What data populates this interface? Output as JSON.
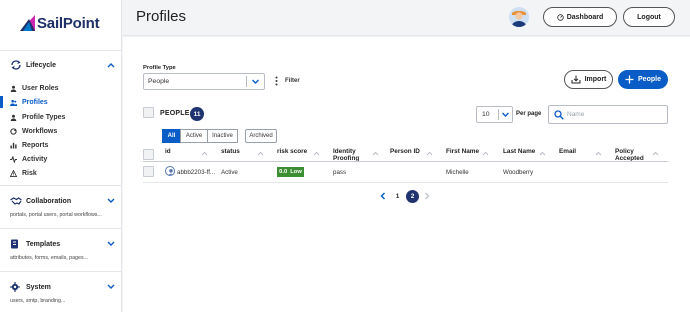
{
  "brand": {
    "name": "SailPoint",
    "color": "#1f2f67",
    "accent": "#0a5cc7"
  },
  "sidebar": {
    "lifecycle": {
      "title": "Lifecycle",
      "items": [
        {
          "label": "User Roles",
          "icon": "user-roles-icon"
        },
        {
          "label": "Profiles",
          "icon": "profiles-icon",
          "active": true
        },
        {
          "label": "Profile Types",
          "icon": "profile-types-icon"
        },
        {
          "label": "Workflows",
          "icon": "workflows-icon"
        },
        {
          "label": "Reports",
          "icon": "reports-icon"
        },
        {
          "label": "Activity",
          "icon": "activity-icon"
        },
        {
          "label": "Risk",
          "icon": "risk-icon"
        }
      ]
    },
    "collaboration": {
      "title": "Collaboration",
      "desc": "portals, portal users, portal workflows..."
    },
    "templates": {
      "title": "Templates",
      "desc": "attributes, forms, emails, pages..."
    },
    "system": {
      "title": "System",
      "desc": "users, smtp, branding..."
    }
  },
  "header": {
    "title": "Profiles",
    "dashboard_label": "Dashboard",
    "logout_label": "Logout"
  },
  "toolbar": {
    "profile_type_label": "Profile Type",
    "profile_type_value": "People",
    "filter_label": "Filter",
    "import_label": "Import",
    "add_label": "People"
  },
  "list": {
    "title": "PEOPLE",
    "count": "11",
    "per_page_value": "10",
    "per_page_label": "Per page",
    "search_placeholder": "Name",
    "filters": [
      "All",
      "Active",
      "Inactive"
    ],
    "archived_label": "Archived"
  },
  "table": {
    "columns": [
      "id",
      "status",
      "risk score",
      "Identity Proofing",
      "Person ID",
      "First Name",
      "Last Name",
      "Email",
      "Policy Accepted"
    ],
    "rows": [
      {
        "id": "abbb2203-ff...",
        "status": "Active",
        "risk_value": "0.0",
        "risk_label": "Low",
        "identity_proofing": "pass",
        "person_id": "",
        "first_name": "Michelle",
        "last_name": "Woodberry",
        "email": "",
        "policy_accepted": ""
      }
    ]
  },
  "pagination": {
    "pages": [
      "1",
      "2"
    ],
    "current": "2"
  },
  "colors": {
    "risk_low": "#3d8f33",
    "badge": "#1e3370"
  }
}
